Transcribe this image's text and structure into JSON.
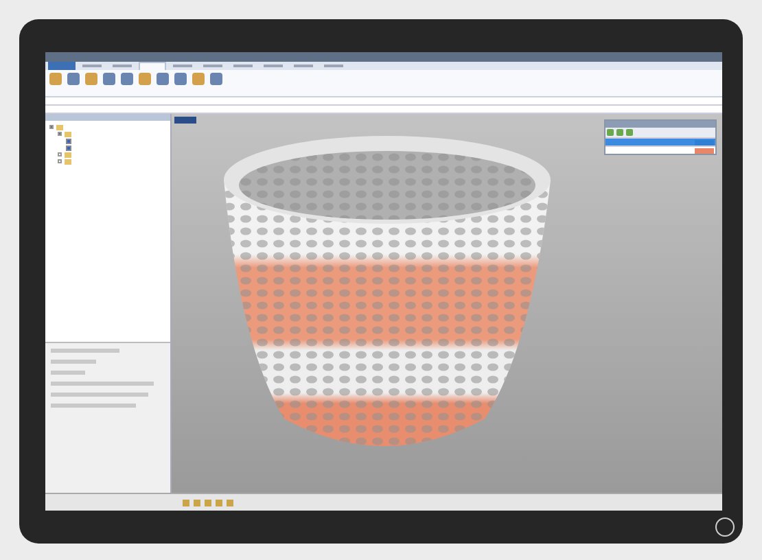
{
  "ribbon": {
    "tabs": [
      {
        "selected": false
      },
      {
        "selected": false
      },
      {
        "selected": false
      },
      {
        "selected": true
      },
      {
        "selected": false
      },
      {
        "selected": false
      },
      {
        "selected": false
      },
      {
        "selected": false
      },
      {
        "selected": false
      },
      {
        "selected": false
      }
    ]
  },
  "tree": [
    {
      "expanded": true,
      "children": [
        {
          "expanded": true,
          "children": [
            {
              "checked": true
            },
            {
              "checked": true
            }
          ]
        },
        {
          "expanded": false
        },
        {
          "expanded": false
        }
      ]
    }
  ],
  "layers": [
    {
      "selected": true,
      "color": "#2f7fd4"
    },
    {
      "selected": false,
      "color": "#e8866a"
    }
  ]
}
